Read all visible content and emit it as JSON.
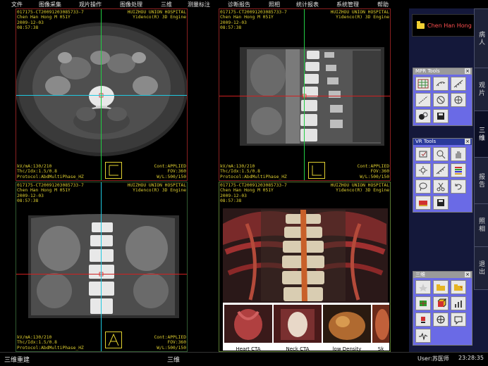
{
  "menu": [
    "文件",
    "图像采集",
    "观片操作",
    "图像处理",
    "三维",
    "测量标注",
    "诊断报告",
    "照相",
    "统计报表",
    "系统管理",
    "帮助"
  ],
  "viewports": [
    {
      "overlay_tl": "017175-CT20091203085733-7\nChen Han Hong M 051Y\n2009-12-03\n08:57:38",
      "overlay_tr": "HUIZHOU UNION HOSPITAL\nYidenco(R) 3D Engine",
      "overlay_bl": "kV/mA:130/210\nThc/Idx:1.5/0.8\nProtocol:AbdMultiPhase_HZ",
      "overlay_br": "Cont:APPLIED\nFOV:360\nW/L:500/150"
    },
    {
      "overlay_tl": "017175-CT20091203085733-7\nChen Han Hong M 051Y\n2009-12-03\n08:57:38",
      "overlay_tr": "HUIZHOU UNION HOSPITAL\nYidenco(R) 3D Engine",
      "overlay_bl": "kV/mA:130/210\nThc/Idx:1.5/0.8\nProtocol:AbdMultiPhase_HZ",
      "overlay_br": "Cont:APPLIED\nFOV:360\nW/L:500/150"
    },
    {
      "overlay_tl": "017175-CT20091203085733-7\nChen Han Hong M 051Y\n2009-12-03\n08:57:38",
      "overlay_tr": "HUIZHOU UNION HOSPITAL\nYidenco(R) 3D Engine",
      "overlay_bl": "kV/mA:130/210\nThc/Idx:1.5/0.8\nProtocol:AbdMultiPhase_HZ",
      "overlay_br": "Cont:APPLIED\nFOV:360\nW/L:500/150"
    },
    {
      "overlay_tl": "017175-CT20091203085733-7\nChen Han Hong M 051Y\n2009-12-03\n08:57:38",
      "overlay_tr": "HUIZHOU UNION HOSPITAL\nYidenco(R) 3D Engine"
    }
  ],
  "vr_presets": [
    "Heart CTA",
    "Neck CTA",
    "low Density",
    "Sk"
  ],
  "patient": {
    "name": "Chen Han Hong"
  },
  "tabs": [
    "病人",
    "观片",
    "三维",
    "报告",
    "照相",
    "退出"
  ],
  "active_tab": "三维",
  "mpr_tools_title": "MPR Tools",
  "vr_tools_title": "VR Tools",
  "sanwei_title": "三维",
  "close_glyph": "×",
  "status": {
    "left": "三维重建",
    "center": "三维",
    "user": "User:苏医师",
    "time": "23:28:35"
  },
  "colors": {
    "crosshair_green": "#22cc44",
    "crosshair_red": "#d02020",
    "crosshair_cyan": "#20c8e0",
    "overlay_yellow": "#e0d030",
    "panel_blue": "#6a6ae6",
    "patient_red": "#ff5050"
  }
}
